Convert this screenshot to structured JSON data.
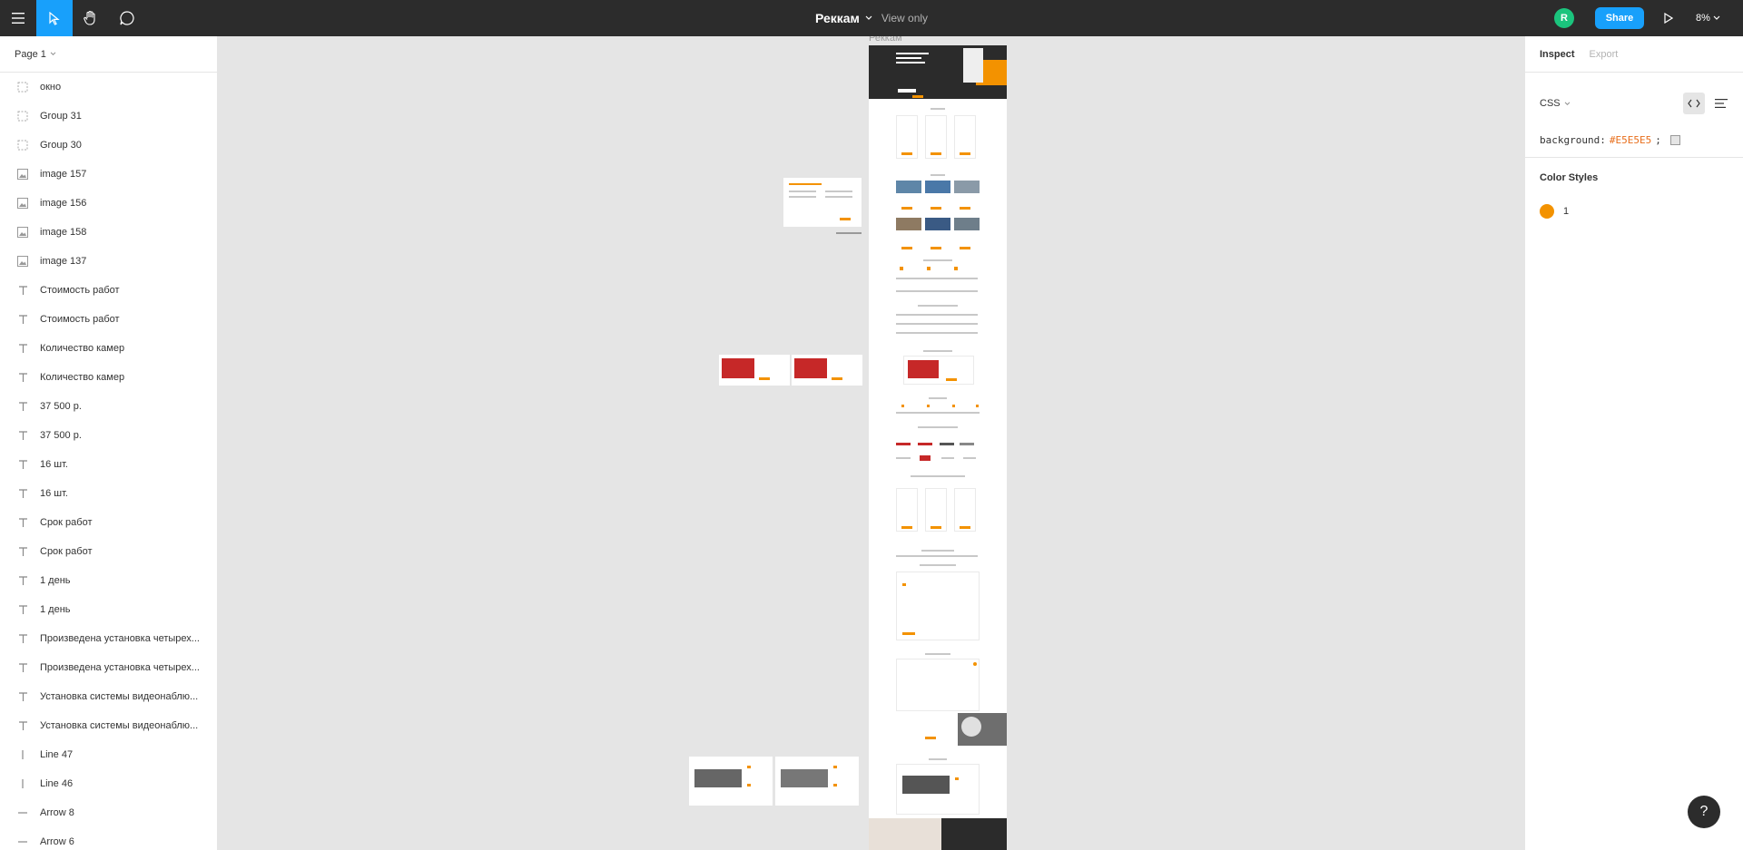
{
  "toolbar": {
    "file_name": "Реккам",
    "mode": "View only",
    "avatar_initial": "R",
    "share_label": "Share",
    "zoom": "8%"
  },
  "left_panel": {
    "page_label": "Page 1",
    "layers": [
      {
        "type": "frame",
        "label": "окно"
      },
      {
        "type": "frame",
        "label": "Group 31"
      },
      {
        "type": "frame",
        "label": "Group 30"
      },
      {
        "type": "image",
        "label": "image 157"
      },
      {
        "type": "image",
        "label": "image 156"
      },
      {
        "type": "image",
        "label": "image 158"
      },
      {
        "type": "image",
        "label": "image 137"
      },
      {
        "type": "text",
        "label": "Стоимость работ"
      },
      {
        "type": "text",
        "label": "Стоимость работ"
      },
      {
        "type": "text",
        "label": "Количество камер"
      },
      {
        "type": "text",
        "label": "Количество камер"
      },
      {
        "type": "text",
        "label": "37 500 р."
      },
      {
        "type": "text",
        "label": "37 500 р."
      },
      {
        "type": "text",
        "label": "16 шт."
      },
      {
        "type": "text",
        "label": "16 шт."
      },
      {
        "type": "text",
        "label": "Срок работ"
      },
      {
        "type": "text",
        "label": "Срок работ"
      },
      {
        "type": "text",
        "label": "1 день"
      },
      {
        "type": "text",
        "label": "1 день"
      },
      {
        "type": "text",
        "label": "Произведена установка четырех..."
      },
      {
        "type": "text",
        "label": "Произведена установка четырех..."
      },
      {
        "type": "text",
        "label": "Установка системы видеонаблю..."
      },
      {
        "type": "text",
        "label": "Установка системы видеонаблю..."
      },
      {
        "type": "line",
        "label": "Line 47"
      },
      {
        "type": "line",
        "label": "Line 46"
      },
      {
        "type": "arrow",
        "label": "Arrow 8"
      },
      {
        "type": "arrow",
        "label": "Arrow 6"
      }
    ]
  },
  "canvas": {
    "frame_label": "Реккам"
  },
  "right_panel": {
    "tab_inspect": "Inspect",
    "tab_export": "Export",
    "code_lang": "CSS",
    "code_property": "background:",
    "code_value": "#E5E5E5",
    "code_suffix": ";",
    "color_styles_title": "Color Styles",
    "color_style_name": "1",
    "color_style_value": "#F39200"
  },
  "help_label": "?"
}
